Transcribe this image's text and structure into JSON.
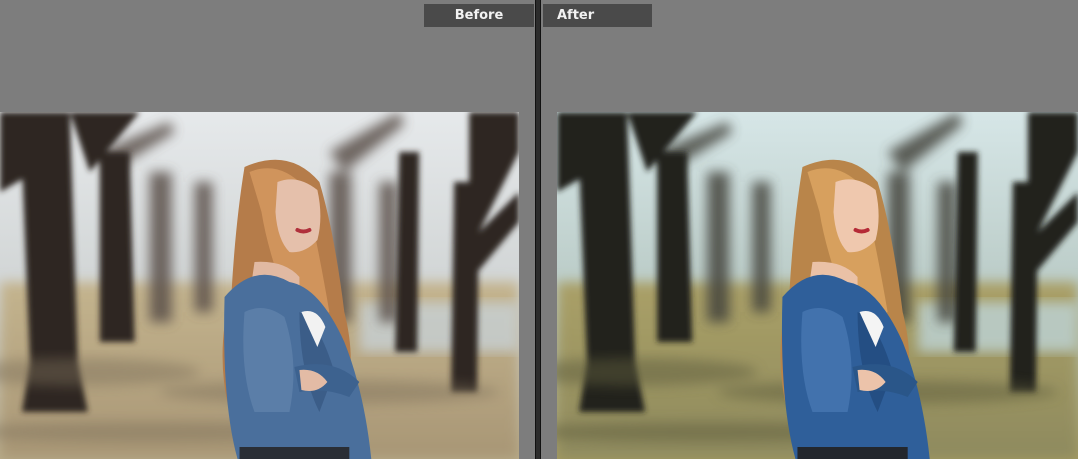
{
  "panes": {
    "before": {
      "label": "Before"
    },
    "after": {
      "label": "After"
    }
  },
  "photo": {
    "subject": "portrait-woman-denim-jacket-tree-lined-path",
    "before_tones": {
      "sky": "#dfe3e6",
      "ground": "#b7a780",
      "trunk": "#2e2622",
      "hair": "#c48a55",
      "jacket": "#4a6f9c",
      "skin": "#e5c0ab"
    },
    "after_tones": {
      "sky": "#cfe2e3",
      "ground": "#a99f63",
      "trunk": "#22231f",
      "hair": "#c49054",
      "jacket": "#2f5f9a",
      "skin": "#efc8ae"
    }
  }
}
